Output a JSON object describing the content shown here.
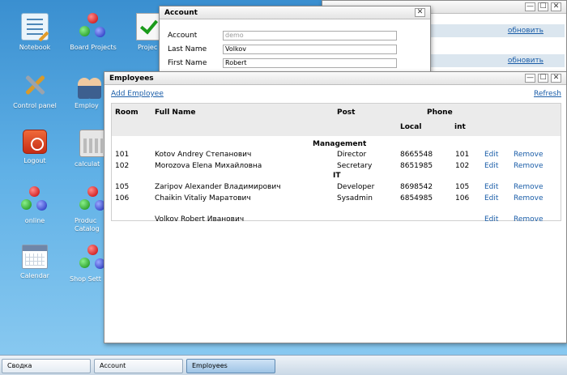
{
  "desktop": {
    "icons": [
      {
        "label": "Notebook"
      },
      {
        "label": "Board Projects"
      },
      {
        "label": "Project Manag"
      },
      {
        "label": "Control panel"
      },
      {
        "label": "Employ"
      },
      {
        "label": "Logout"
      },
      {
        "label": "calculat"
      },
      {
        "label": "online"
      },
      {
        "label": "Produc Catalog"
      },
      {
        "label": "Calendar"
      },
      {
        "label": "Shop Sett"
      }
    ]
  },
  "bg_window": {
    "link1": "обновить",
    "link2": "обновить"
  },
  "account": {
    "title": "Account",
    "close": "✕",
    "fields": [
      {
        "label": "Account",
        "value": "",
        "placeholder": "demo"
      },
      {
        "label": "Last Name",
        "value": "Volkov"
      },
      {
        "label": "First Name",
        "value": "Robert"
      }
    ]
  },
  "employees": {
    "title": "Employees",
    "add_label": "Add Employee",
    "refresh_label": "Refresh",
    "columns": {
      "room": "Room",
      "full_name": "Full Name",
      "post": "Post",
      "phone": "Phone",
      "local": "Local",
      "int": "int"
    },
    "groups": [
      {
        "name": "Management",
        "rows": [
          {
            "room": "101",
            "name": "Kotov Andrey Степанович",
            "post": "Director",
            "local": "8665548",
            "int": "101",
            "edit": "Edit",
            "remove": "Remove"
          },
          {
            "room": "102",
            "name": "Morozova Elena Михайловна",
            "post": "Secretary",
            "local": "8651985",
            "int": "102",
            "edit": "Edit",
            "remove": "Remove"
          }
        ]
      },
      {
        "name": "IT",
        "rows": [
          {
            "room": "105",
            "name": "Zaripov Alexander Владимирович",
            "post": "Developer",
            "local": "8698542",
            "int": "105",
            "edit": "Edit",
            "remove": "Remove"
          },
          {
            "room": "106",
            "name": "Chaikin Vitaliy Маратович",
            "post": "Sysadmin",
            "local": "6854985",
            "int": "106",
            "edit": "Edit",
            "remove": "Remove"
          }
        ]
      }
    ],
    "ungrouped": [
      {
        "room": "",
        "name": "Volkov Robert Иванович",
        "post": "",
        "local": "",
        "int": "",
        "edit": "Edit",
        "remove": "Remove"
      }
    ]
  },
  "taskbar": {
    "items": [
      "Сводка",
      "Account",
      "Employees"
    ],
    "active": "Employees"
  }
}
